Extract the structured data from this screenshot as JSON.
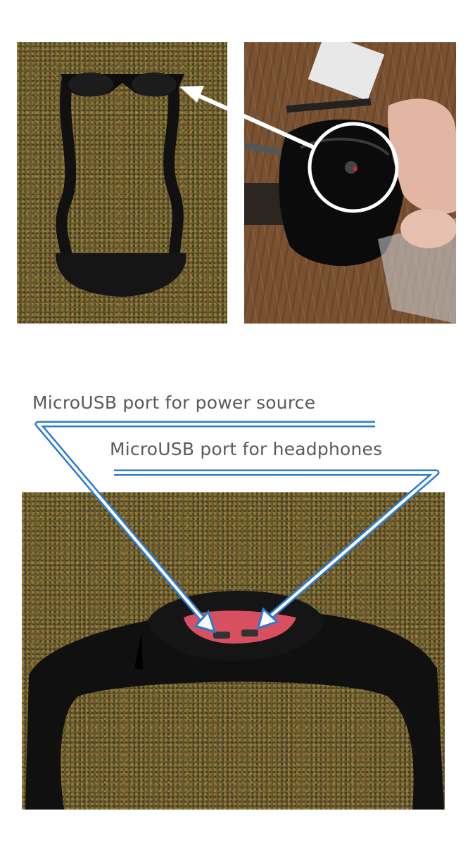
{
  "callouts": {
    "power_label": "MicroUSB port for power source",
    "headphones_label": "MicroUSB port for headphones"
  },
  "photos": [
    {
      "id": "photo-glasses-strap",
      "subject": "sunglasses with neoprene strap on carpet"
    },
    {
      "id": "photo-lens-sensor",
      "subject": "hand holding sunglasses lens with circled sensor"
    },
    {
      "id": "photo-pouch-ports",
      "subject": "strap pouch showing MicroUSB ports"
    }
  ],
  "colors": {
    "callout_blue": "#2a7bd4",
    "label_gray": "#5a5a5a",
    "strap_black": "#111111",
    "board_red": "#d8505f"
  }
}
